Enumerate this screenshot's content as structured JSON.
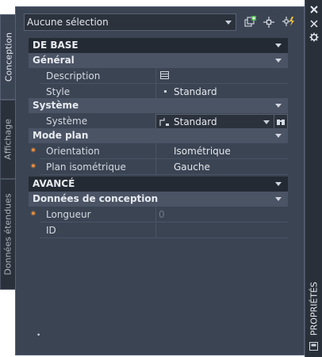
{
  "tabs": {
    "conception": "Conception",
    "affichage": "Affichage",
    "donnees_etendues": "Données étendues"
  },
  "selector": {
    "value": "Aucune sélection"
  },
  "sections": {
    "de_base": "DE BASE",
    "general": "Général",
    "systeme": "Système",
    "mode_plan": "Mode plan",
    "avance": "AVANCÉ",
    "donnees_conception": "Données de conception"
  },
  "general": {
    "description_label": "Description",
    "style_label": "Style",
    "style_value": "Standard"
  },
  "systeme": {
    "label": "Système",
    "value": "Standard"
  },
  "mode_plan": {
    "orientation_label": "Orientation",
    "orientation_value": "Isométrique",
    "plan_label": "Plan isométrique",
    "plan_value": "Gauche"
  },
  "donnees": {
    "longueur_label": "Longueur",
    "longueur_value": "0",
    "id_label": "ID",
    "id_value": ""
  },
  "palette": {
    "title": "PROPRIÉTÉS",
    "controls": [
      "close-icon",
      "auto-hide-icon",
      "properties-menu-icon"
    ]
  }
}
